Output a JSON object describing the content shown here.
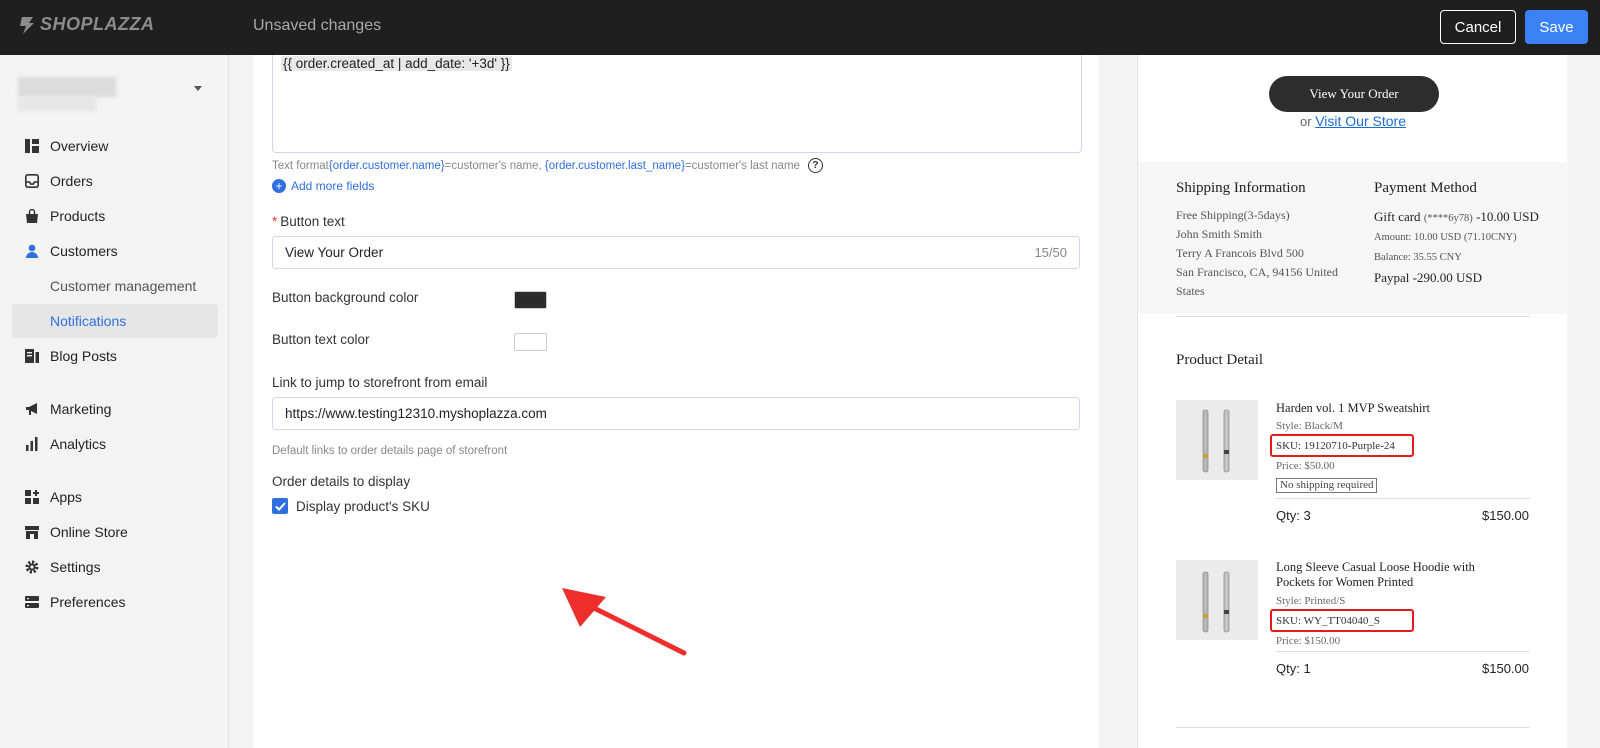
{
  "topbar": {
    "brand": "SHOPLAZZA",
    "status": "Unsaved changes",
    "cancel_label": "Cancel",
    "save_label": "Save"
  },
  "sidebar": {
    "items": [
      {
        "label": "Overview",
        "icon": "dashboard-icon"
      },
      {
        "label": "Orders",
        "icon": "inbox-icon"
      },
      {
        "label": "Products",
        "icon": "bag-icon"
      },
      {
        "label": "Customers",
        "icon": "person-icon"
      },
      {
        "label": "Customer management"
      },
      {
        "label": "Notifications"
      },
      {
        "label": "Blog Posts",
        "icon": "blog-icon"
      },
      {
        "label": "Marketing",
        "icon": "megaphone-icon"
      },
      {
        "label": "Analytics",
        "icon": "bar-chart-icon"
      },
      {
        "label": "Apps",
        "icon": "apps-icon"
      },
      {
        "label": "Online Store",
        "icon": "store-icon"
      },
      {
        "label": "Settings",
        "icon": "gear-icon"
      },
      {
        "label": "Preferences",
        "icon": "preferences-icon"
      }
    ]
  },
  "form": {
    "template_code": "{{ order.created_at | add_date: '+3d' }}",
    "hint_prefix": "Text format",
    "hint_var1": "{order.customer.name}",
    "hint_mid": "=customer's name, ",
    "hint_var2": "{order.customer.last_name}",
    "hint_suffix": "=customer's last name",
    "add_more": "Add more fields",
    "button_text_label": "Button text",
    "button_text_value": "View Your Order",
    "button_text_counter": "15/50",
    "bg_color_label": "Button background color",
    "bg_color": "#2b2b2b",
    "text_color_label": "Button text color",
    "text_color": "#ffffff",
    "link_label": "Link to jump to storefront from email",
    "link_value": "https://www.testing12310.myshoplazza.com",
    "link_hint": "Default links to order details page of storefront",
    "order_details_label": "Order details to display",
    "display_sku_label": "Display product's SKU",
    "display_sku_checked": true
  },
  "preview": {
    "view_button": "View Your Order",
    "or_text": "or",
    "visit_link": "Visit Our Store",
    "shipping_title": "Shipping Information",
    "shipping_lines": [
      "Free Shipping(3-5days)",
      "John Smith Smith",
      "Terry A Francois Blvd 500",
      "San Francisco, CA, 94156 United",
      "States"
    ],
    "payment_title": "Payment Method",
    "gift_card": "Gift card",
    "gift_card_code": "(****6y78)",
    "gift_card_amount": "-10.00 USD",
    "amount_line": "Amount:  10.00 USD  (71.10CNY)",
    "balance_line": "Balance:  35.55 CNY",
    "paypal": "Paypal",
    "paypal_amount": "-290.00 USD",
    "product_detail_title": "Product Detail",
    "products": [
      {
        "name": "Harden vol. 1 MVP Sweatshirt",
        "style": "Style: Black/M",
        "sku": "SKU: 19120710-Purple-24",
        "price": "Price: $50.00",
        "badge": "No shipping required",
        "qty": "Qty: 3",
        "total": "$150.00"
      },
      {
        "name": "Long Sleeve Casual Loose Hoodie with Pockets for Women Printed",
        "style": "Style: Printed/S",
        "sku": "SKU: WY_TT04040_S",
        "price": "Price: $150.00",
        "badge": "",
        "qty": "Qty: 1",
        "total": "$150.00"
      }
    ]
  },
  "colors": {
    "accent": "#2f6fe0",
    "highlight": "#e01c1c",
    "topbar": "#1f1f1f"
  }
}
